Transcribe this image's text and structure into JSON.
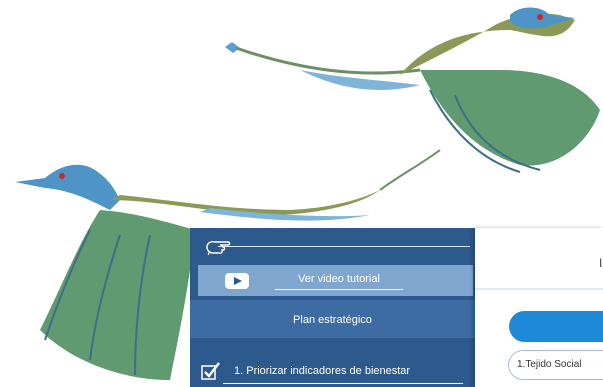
{
  "sidebar": {
    "video_label": "Ver video tutorial",
    "plan_label": "Plan estratégico",
    "item_1_label": "1. Priorizar indicadores de bienestar",
    "icons": [
      "hand-pointer-icon",
      "youtube-play-icon",
      "checkbox-checked-icon"
    ]
  },
  "content": {
    "header_letter": "I",
    "select_value": "1.Tejido Social"
  },
  "colors": {
    "sidebar_bg": "#2c5a8c",
    "video_row_bg": "#7fa6cf",
    "plan_row_bg": "#3c6ca2",
    "primary_button": "#1e88d9"
  }
}
